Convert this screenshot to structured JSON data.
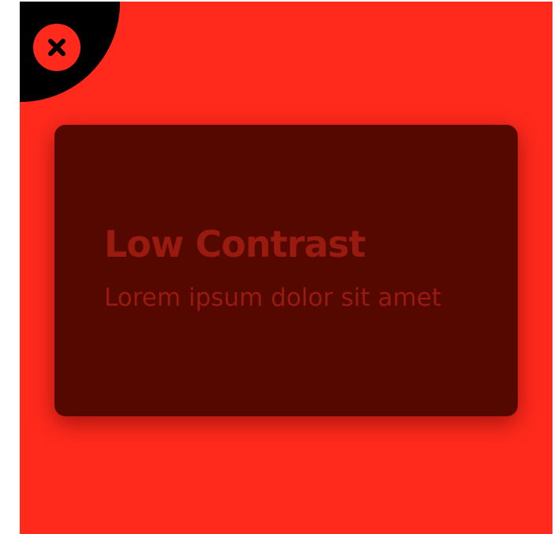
{
  "colors": {
    "background": "#ff2a1c",
    "corner": "#000000",
    "card": "#550800",
    "card_text": "#991a0e"
  },
  "close_button": {
    "icon": "close-icon"
  },
  "card": {
    "title": "Low Contrast",
    "body": "Lorem ipsum dolor sit amet"
  }
}
